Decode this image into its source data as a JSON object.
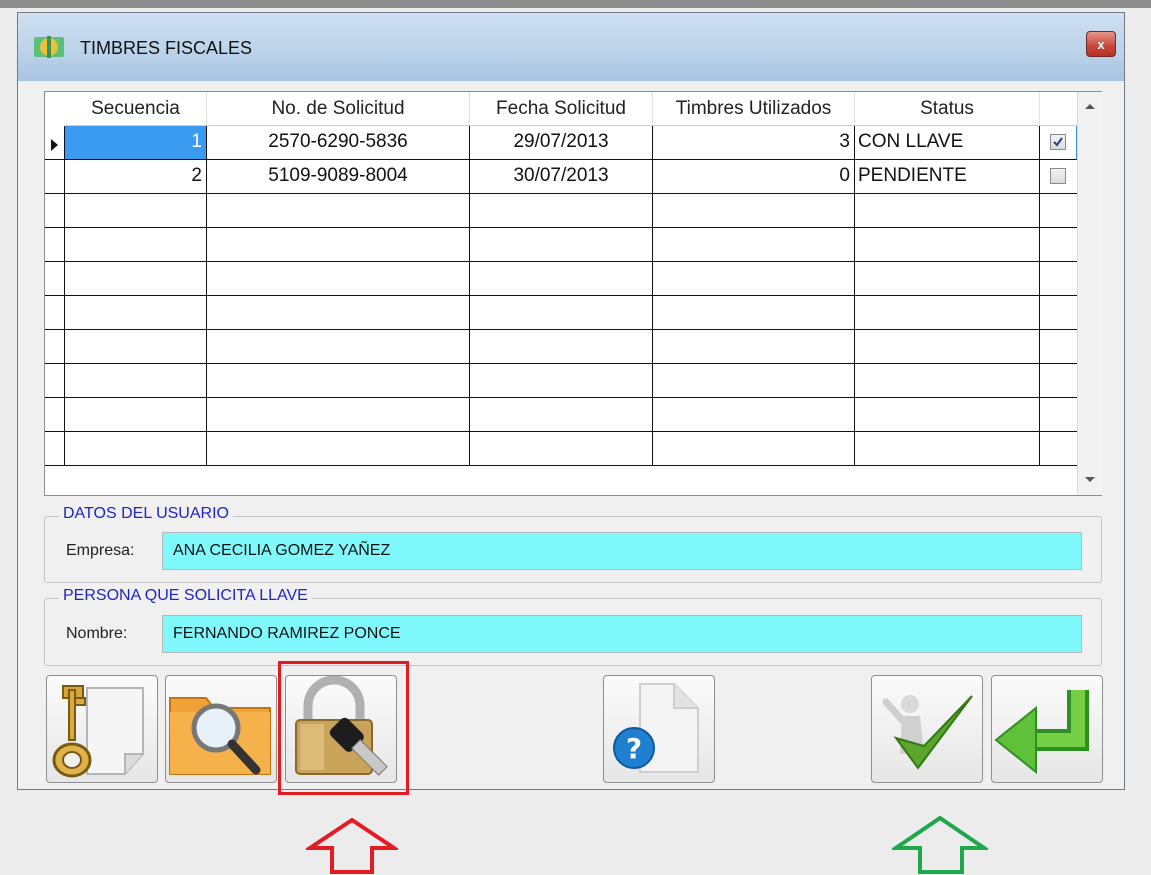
{
  "window": {
    "title": "TIMBRES FISCALES",
    "close_glyph": "x"
  },
  "grid": {
    "columns": [
      "Secuencia",
      "No. de Solicitud",
      "Fecha Solicitud",
      "Timbres Utilizados",
      "Status"
    ],
    "rows": [
      {
        "secuencia": "1",
        "solicitud": "2570-6290-5836",
        "fecha": "29/07/2013",
        "timbres": "3",
        "status": "CON LLAVE",
        "checked": true,
        "selected": true
      },
      {
        "secuencia": "2",
        "solicitud": "5109-9089-8004",
        "fecha": "30/07/2013",
        "timbres": "0",
        "status": "PENDIENTE",
        "checked": false,
        "selected": false
      }
    ],
    "empty_row_count": 8
  },
  "usuario": {
    "group_label": "DATOS DEL USUARIO",
    "empresa_label": "Empresa:",
    "empresa_value": "ANA CECILIA GOMEZ YAÑEZ"
  },
  "persona": {
    "group_label": "PERSONA QUE SOLICITA LLAVE",
    "nombre_label": "Nombre:",
    "nombre_value": "FERNANDO RAMIREZ PONCE"
  },
  "toolbar": {
    "buttons": [
      {
        "name": "key-document-button",
        "icon": "key-document-icon"
      },
      {
        "name": "search-folder-button",
        "icon": "folder-search-icon"
      },
      {
        "name": "padlock-key-button",
        "icon": "padlock-key-icon",
        "highlighted": true
      },
      {
        "name": "help-document-button",
        "icon": "help-document-icon"
      },
      {
        "name": "accept-button",
        "icon": "checkmark-person-icon"
      },
      {
        "name": "return-button",
        "icon": "return-arrow-icon"
      }
    ]
  },
  "annotations": {
    "highlight_color": "#e51b23",
    "red_arrow_color": "#e51b23",
    "green_arrow_color": "#1ea84a"
  },
  "colors": {
    "field_background": "#7ff9fb",
    "group_label": "#1f24c7",
    "selected_cell": "#3a9bf0",
    "titlebar": "#bcd3ea"
  }
}
